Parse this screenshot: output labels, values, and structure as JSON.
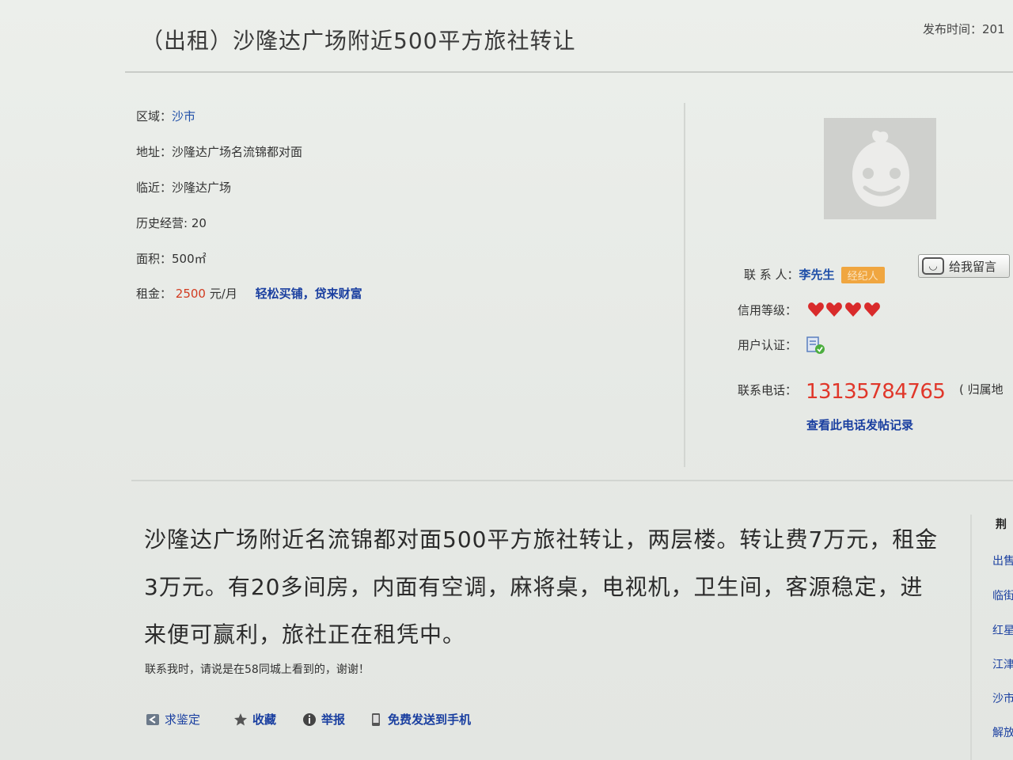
{
  "header": {
    "title": "（出租）沙隆达广场附近500平方旅社转让",
    "publish_label": "发布时间：",
    "publish_value": "201"
  },
  "details": {
    "area_label": "区域：",
    "area_value": "沙市",
    "address_label": "地址：",
    "address_value": "沙隆达广场名流锦都对面",
    "nearby_label": "临近：",
    "nearby_value": "沙隆达广场",
    "history_label": "历史经营:",
    "history_value": "20",
    "size_label": "面积：",
    "size_value": "500㎡",
    "rent_label": "租金：",
    "rent_amount": "2500",
    "rent_unit": "元/月",
    "rent_link": "轻松买铺，贷来财富"
  },
  "contact": {
    "person_label": "联 系 人：",
    "person_name": "李先生",
    "badge": "经纪人",
    "message_button": "给我留言",
    "credit_label": "信用等级：",
    "credit_hearts": 4,
    "verify_label": "用户认证：",
    "phone_label": "联系电话：",
    "phone_number": "13135784765",
    "phone_region": "( 归属地",
    "phone_history_link": "查看此电话发帖记录",
    "accent_color": "#e0372a",
    "link_color": "#1a3fa0"
  },
  "description": {
    "text": "沙隆达广场附近名流锦都对面500平方旅社转让，两层楼。转让费7万元，租金3万元。有20多间房，内面有空调，麻将桌，电视机，卫生间，客源稳定，进来便可赢利，旅社正在租凭中。",
    "notice": "联系我时，请说是在58同城上看到的，谢谢！"
  },
  "actions": {
    "appraise": "求鉴定",
    "favorite": "收藏",
    "report": "举报",
    "send_phone": "免费发送到手机"
  },
  "sidebar": {
    "heading": "荆",
    "items": [
      "出售",
      "临街",
      "红星",
      "江津",
      "沙市",
      "解放"
    ]
  }
}
